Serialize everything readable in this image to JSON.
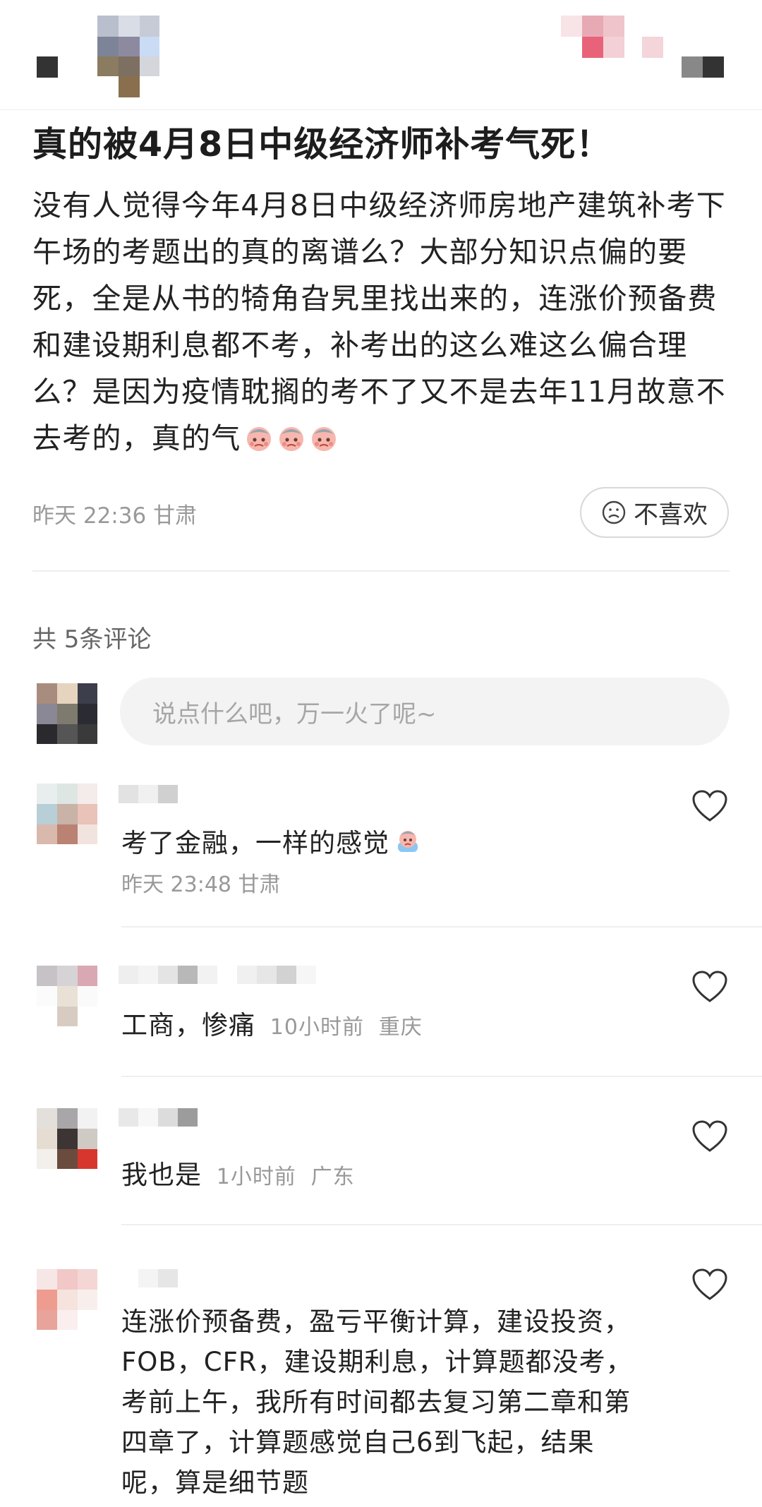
{
  "post": {
    "title": "真的被4月8日中级经济师补考气死！",
    "body": "没有人觉得今年4月8日中级经济师房地产建筑补考下午场的考题出的真的离谱么？大部分知识点偏的要死，全是从书的犄角旮旯里找出来的，连涨价预备费和建设期利息都不考，补考出的这么难这么偏合理么？是因为疫情耽搁的考不了又不是去年11月故意不去考的，真的气",
    "time": "昨天 22:36",
    "location": "甘肃",
    "dislike_label": "不喜欢",
    "emoji_icon": "crying-face-emoji"
  },
  "comments_section": {
    "count_label": "共 5条评论",
    "input_placeholder": "说点什么吧，万一火了呢~"
  },
  "comments": [
    {
      "text": "考了金融，一样的感觉",
      "time": "昨天 23:48",
      "location": "甘肃"
    },
    {
      "text": "工商，惨痛",
      "time": "10小时前",
      "location": "重庆"
    },
    {
      "text": "我也是",
      "time": "1小时前",
      "location": "广东"
    },
    {
      "text": "连涨价预备费，盈亏平衡计算，建设投资，FOB，CFR，建设期利息，计算题都没考，考前上午，我所有时间都去复习第二章和第四章了，计算题感觉自己6到飞起，结果呢，算是细节题",
      "time": "",
      "location": ""
    }
  ],
  "colors": {
    "text": "#222222",
    "muted": "#999999",
    "input_bg": "#f3f3f3",
    "accent_pink": "#e8637a"
  }
}
